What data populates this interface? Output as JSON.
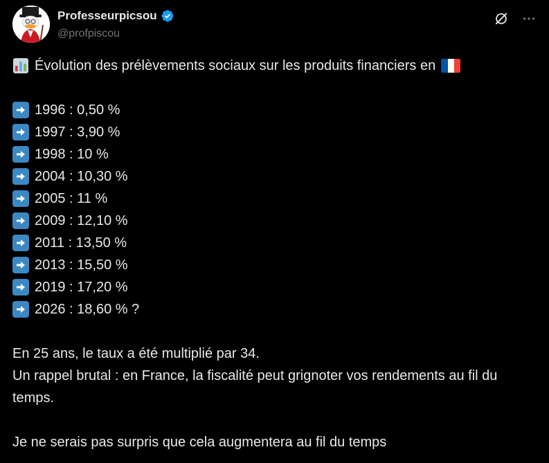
{
  "post": {
    "author": {
      "display_name": "Professeurpicsou",
      "handle": "@profpiscou",
      "verified_icon": "verified-badge-icon"
    },
    "actions": {
      "grok_icon": "grok-icon",
      "more_icon": "more-options-icon"
    },
    "title": {
      "emoji": "bar-chart-icon",
      "text": "Évolution des prélèvements sociaux sur les produits financiers en",
      "flag": "france-flag-icon"
    },
    "rates": [
      {
        "text": "1996 : 0,50 %"
      },
      {
        "text": "1997 : 3,90 %"
      },
      {
        "text": "1998 : 10 %"
      },
      {
        "text": "2004 : 10,30 %"
      },
      {
        "text": "2005 : 11 %"
      },
      {
        "text": "2009 : 12,10 %"
      },
      {
        "text": "2011 : 13,50 %"
      },
      {
        "text": "2013 : 15,50 %"
      },
      {
        "text": "2019 : 17,20 %"
      },
      {
        "text": "2026 : 18,60 % ?"
      }
    ],
    "paragraph1_line1": "En 25 ans, le taux a été multiplié par 34.",
    "paragraph1_line2": "Un rappel brutal : en France, la fiscalité peut grignoter vos rendements au fil du temps.",
    "paragraph2": "Je ne serais pas surpris que cela augmentera au fil du temps"
  },
  "colors": {
    "background": "#000000",
    "text": "#e7e9ea",
    "secondary_text": "#71767b",
    "verified_blue": "#1d9bf0",
    "arrow_box": "#3b88c3"
  }
}
